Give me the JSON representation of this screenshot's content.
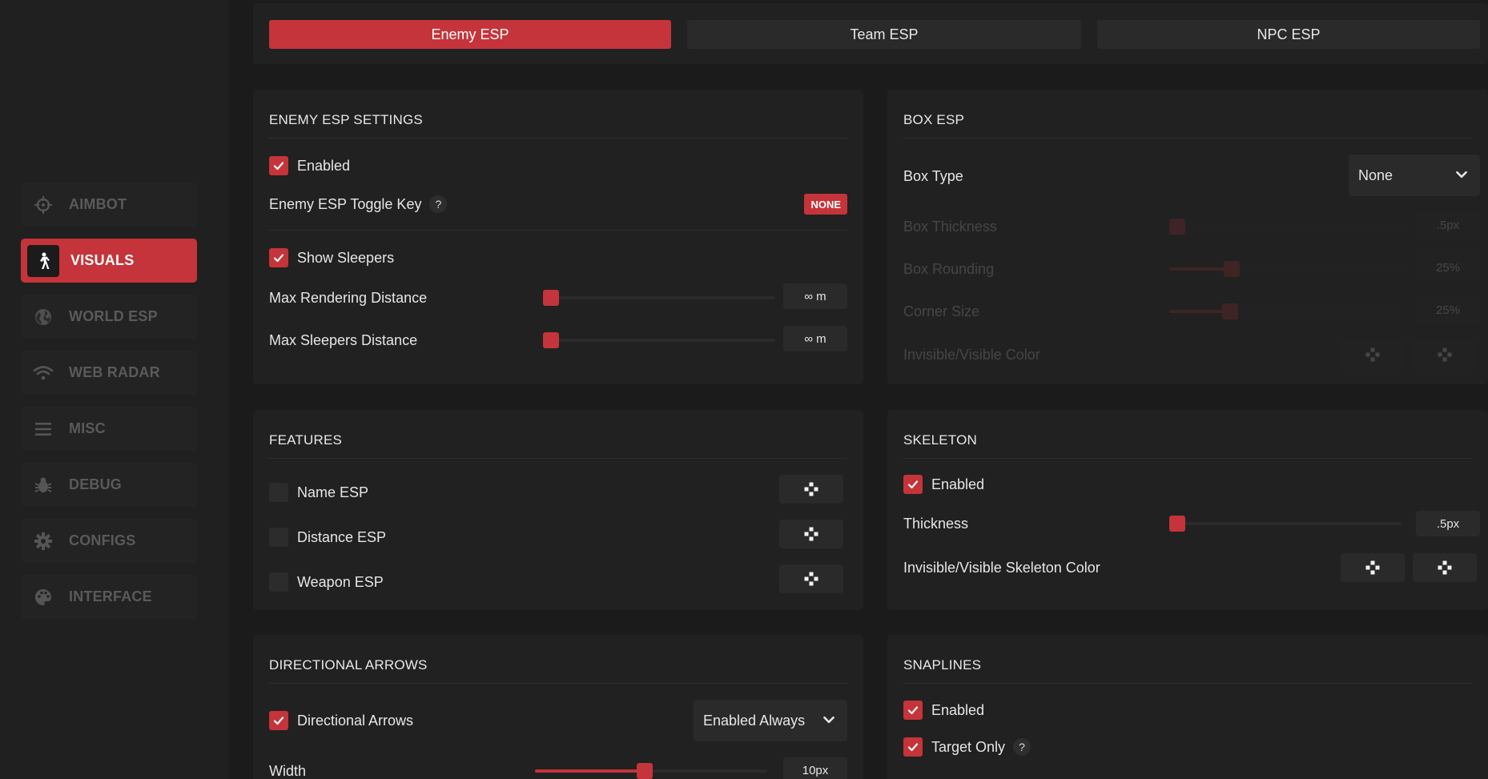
{
  "sidebar": {
    "items": [
      {
        "label": "AIMBOT",
        "icon": "crosshair-icon",
        "active": false
      },
      {
        "label": "VISUALS",
        "icon": "walking-person-icon",
        "active": true
      },
      {
        "label": "WORLD ESP",
        "icon": "globe-icon",
        "active": false
      },
      {
        "label": "WEB RADAR",
        "icon": "wifi-icon",
        "active": false
      },
      {
        "label": "MISC",
        "icon": "menu-icon",
        "active": false
      },
      {
        "label": "DEBUG",
        "icon": "bug-icon",
        "active": false
      },
      {
        "label": "CONFIGS",
        "icon": "gear-icon",
        "active": false
      },
      {
        "label": "INTERFACE",
        "icon": "palette-icon",
        "active": false
      }
    ]
  },
  "tabs": [
    {
      "label": "Enemy ESP",
      "active": true
    },
    {
      "label": "Team ESP",
      "active": false
    },
    {
      "label": "NPC ESP",
      "active": false
    }
  ],
  "enemy_settings": {
    "title": "ENEMY ESP SETTINGS",
    "enabled_label": "Enabled",
    "enabled": true,
    "toggle_key_label": "Enemy ESP Toggle Key",
    "help": "?",
    "toggle_key_value": "NONE",
    "show_sleepers_label": "Show Sleepers",
    "show_sleepers": true,
    "max_render_label": "Max Rendering Distance",
    "max_render_value": "∞ m",
    "max_render_level": 0,
    "max_sleepers_label": "Max Sleepers Distance",
    "max_sleepers_value": "∞ m",
    "max_sleepers_level": 0
  },
  "box_esp": {
    "title": "BOX ESP",
    "box_type_label": "Box Type",
    "box_type_value": "None",
    "thickness_label": "Box Thickness",
    "thickness_value": ".5px",
    "rounding_label": "Box Rounding",
    "rounding_value": "25%",
    "corner_label": "Corner Size",
    "corner_value": "25%",
    "color_label": "Invisible/Visible Color"
  },
  "features": {
    "title": "FEATURES",
    "items": [
      {
        "label": "Name ESP",
        "checked": false
      },
      {
        "label": "Distance ESP",
        "checked": false
      },
      {
        "label": "Weapon ESP",
        "checked": false
      }
    ]
  },
  "skeleton": {
    "title": "SKELETON",
    "enabled_label": "Enabled",
    "enabled": true,
    "thickness_label": "Thickness",
    "thickness_value": ".5px",
    "thickness_level": 0,
    "color_label": "Invisible/Visible Skeleton Color"
  },
  "arrows": {
    "title": "DIRECTIONAL ARROWS",
    "toggle_label": "Directional Arrows",
    "toggle": true,
    "mode_value": "Enabled Always",
    "width_label": "Width",
    "width_value": "10px",
    "width_level": 0.47
  },
  "snaplines": {
    "title": "SNAPLINES",
    "enabled_label": "Enabled",
    "enabled": true,
    "target_only_label": "Target Only",
    "target_only": true,
    "help": "?"
  },
  "colors": {
    "accent": "#c5343a",
    "bg": "#1b1b1b",
    "panel": "#212121",
    "control": "#2a2a2a"
  }
}
